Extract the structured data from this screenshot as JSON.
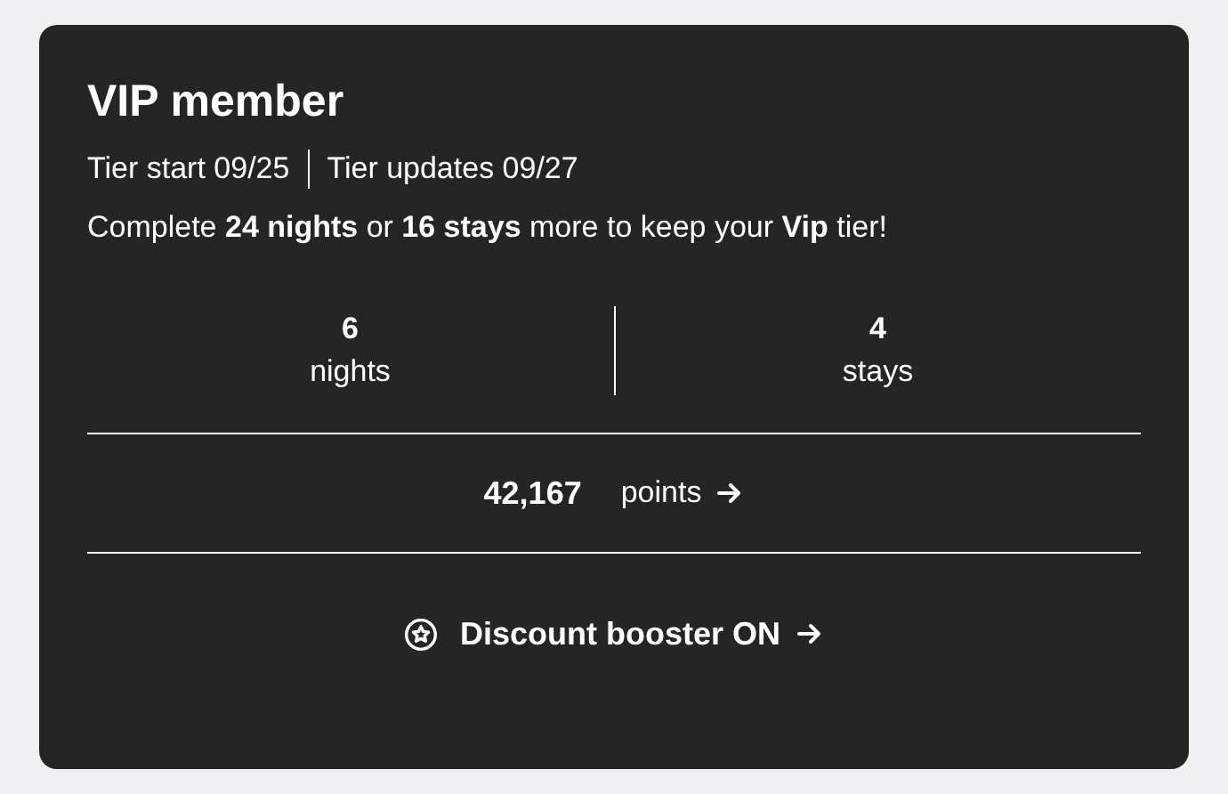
{
  "card": {
    "title": "VIP member",
    "tier_start": "Tier start 09/25",
    "tier_updates": "Tier updates 09/27",
    "message": "Complete **24 nights** or **16 stays** more to keep your **Vip** tier!",
    "stats": [
      {
        "value": "6",
        "label": "nights"
      },
      {
        "value": "4",
        "label": "stays"
      }
    ],
    "points": {
      "value": "42,167",
      "label": "points"
    },
    "booster": {
      "label": "Discount booster ON"
    }
  }
}
